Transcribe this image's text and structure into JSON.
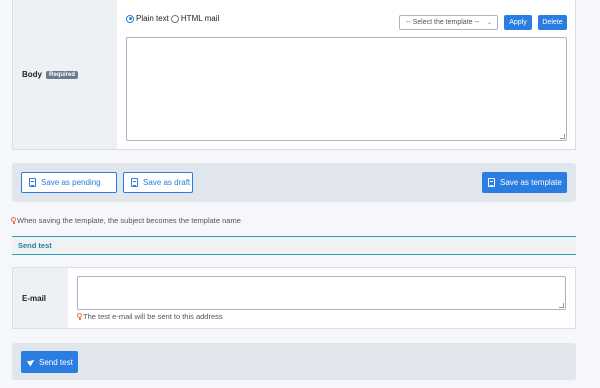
{
  "body_field": {
    "label": "Body",
    "required_badge": "Required",
    "format_options": [
      {
        "label": "Plain text",
        "checked": true
      },
      {
        "label": "HTML mail",
        "checked": false
      }
    ],
    "template_select": {
      "selected": "-- Select the template --"
    },
    "apply_label": "Apply",
    "delete_label": "Delete",
    "textarea_value": ""
  },
  "actions": {
    "save_pending_label": "Save as pending",
    "save_draft_label": "Save as draft",
    "save_template_label": "Save as template"
  },
  "template_hint": "When saving the template, the subject becomes the template name",
  "send_test": {
    "title": "Send test",
    "email_label": "E-mail",
    "email_value": "",
    "email_hint": "The test e-mail will be sent to this address",
    "send_label": "Send test"
  },
  "colors": {
    "primary": "#2a7de1",
    "hint_icon": "#e8774a",
    "section_accent": "#2a9fb8"
  }
}
